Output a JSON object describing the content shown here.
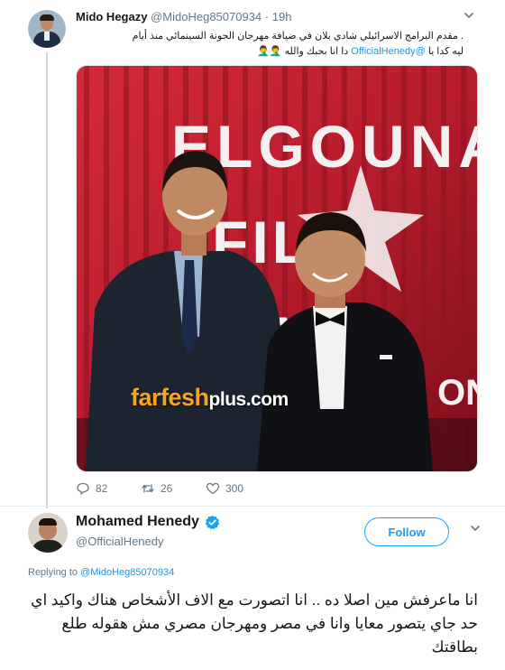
{
  "tweet1": {
    "display_name": "Mido Hegazy",
    "handle": "@MidoHeg85070934",
    "separator": "·",
    "time": "19h",
    "text_line1": ". مقدم البرامج الاسرائيلي شادي بلان في ضيافة مهرجان الجونة السينمائي منذ أيام",
    "text_line2_prefix": "ليه كدا يا ",
    "text_line2_mention": "@OfficialHenedy",
    "text_line2_suffix": " دا انا بحبك والله 🤦‍♂️🤦‍♂️",
    "photo": {
      "backdrop_text": "EL GOUNA FILM FESTIVAL",
      "watermark_part1": "farfesh",
      "watermark_part2": "plus.com"
    },
    "actions": {
      "replies": "82",
      "retweets": "26",
      "likes": "300"
    }
  },
  "tweet2": {
    "display_name": "Mohamed Henedy",
    "handle": "@OfficialHenedy",
    "follow_label": "Follow",
    "replying_label": "Replying to ",
    "replying_mention": "@MidoHeg85070934",
    "text": "انا ماعرفش مين اصلا ده .. انا اتصورت مع الاف الأشخاص هناك واكيد اي حد جاي يتصور معايا وانا في مصر ومهرجان مصري مش هقوله طلع بطاقتك"
  },
  "colors": {
    "link_blue": "#1b95e0",
    "follow_blue": "#1da1f2",
    "secondary_text": "#657786",
    "watermark_orange": "#f6a31e"
  },
  "icons": {
    "reply": "reply-icon",
    "retweet": "retweet-icon",
    "like": "heart-icon",
    "verified": "verified-badge-icon",
    "more": "chevron-down-icon"
  }
}
